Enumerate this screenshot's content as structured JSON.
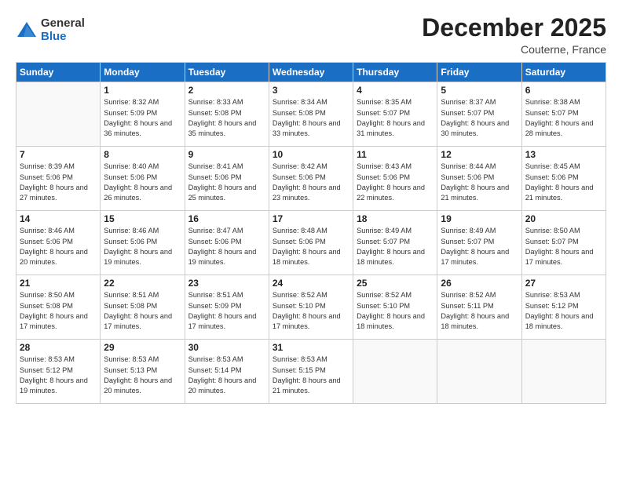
{
  "logo": {
    "general": "General",
    "blue": "Blue"
  },
  "title": "December 2025",
  "location": "Couterne, France",
  "weekdays": [
    "Sunday",
    "Monday",
    "Tuesday",
    "Wednesday",
    "Thursday",
    "Friday",
    "Saturday"
  ],
  "weeks": [
    [
      {
        "num": "",
        "sunrise": "",
        "sunset": "",
        "daylight": ""
      },
      {
        "num": "1",
        "sunrise": "Sunrise: 8:32 AM",
        "sunset": "Sunset: 5:09 PM",
        "daylight": "Daylight: 8 hours and 36 minutes."
      },
      {
        "num": "2",
        "sunrise": "Sunrise: 8:33 AM",
        "sunset": "Sunset: 5:08 PM",
        "daylight": "Daylight: 8 hours and 35 minutes."
      },
      {
        "num": "3",
        "sunrise": "Sunrise: 8:34 AM",
        "sunset": "Sunset: 5:08 PM",
        "daylight": "Daylight: 8 hours and 33 minutes."
      },
      {
        "num": "4",
        "sunrise": "Sunrise: 8:35 AM",
        "sunset": "Sunset: 5:07 PM",
        "daylight": "Daylight: 8 hours and 31 minutes."
      },
      {
        "num": "5",
        "sunrise": "Sunrise: 8:37 AM",
        "sunset": "Sunset: 5:07 PM",
        "daylight": "Daylight: 8 hours and 30 minutes."
      },
      {
        "num": "6",
        "sunrise": "Sunrise: 8:38 AM",
        "sunset": "Sunset: 5:07 PM",
        "daylight": "Daylight: 8 hours and 28 minutes."
      }
    ],
    [
      {
        "num": "7",
        "sunrise": "Sunrise: 8:39 AM",
        "sunset": "Sunset: 5:06 PM",
        "daylight": "Daylight: 8 hours and 27 minutes."
      },
      {
        "num": "8",
        "sunrise": "Sunrise: 8:40 AM",
        "sunset": "Sunset: 5:06 PM",
        "daylight": "Daylight: 8 hours and 26 minutes."
      },
      {
        "num": "9",
        "sunrise": "Sunrise: 8:41 AM",
        "sunset": "Sunset: 5:06 PM",
        "daylight": "Daylight: 8 hours and 25 minutes."
      },
      {
        "num": "10",
        "sunrise": "Sunrise: 8:42 AM",
        "sunset": "Sunset: 5:06 PM",
        "daylight": "Daylight: 8 hours and 23 minutes."
      },
      {
        "num": "11",
        "sunrise": "Sunrise: 8:43 AM",
        "sunset": "Sunset: 5:06 PM",
        "daylight": "Daylight: 8 hours and 22 minutes."
      },
      {
        "num": "12",
        "sunrise": "Sunrise: 8:44 AM",
        "sunset": "Sunset: 5:06 PM",
        "daylight": "Daylight: 8 hours and 21 minutes."
      },
      {
        "num": "13",
        "sunrise": "Sunrise: 8:45 AM",
        "sunset": "Sunset: 5:06 PM",
        "daylight": "Daylight: 8 hours and 21 minutes."
      }
    ],
    [
      {
        "num": "14",
        "sunrise": "Sunrise: 8:46 AM",
        "sunset": "Sunset: 5:06 PM",
        "daylight": "Daylight: 8 hours and 20 minutes."
      },
      {
        "num": "15",
        "sunrise": "Sunrise: 8:46 AM",
        "sunset": "Sunset: 5:06 PM",
        "daylight": "Daylight: 8 hours and 19 minutes."
      },
      {
        "num": "16",
        "sunrise": "Sunrise: 8:47 AM",
        "sunset": "Sunset: 5:06 PM",
        "daylight": "Daylight: 8 hours and 19 minutes."
      },
      {
        "num": "17",
        "sunrise": "Sunrise: 8:48 AM",
        "sunset": "Sunset: 5:06 PM",
        "daylight": "Daylight: 8 hours and 18 minutes."
      },
      {
        "num": "18",
        "sunrise": "Sunrise: 8:49 AM",
        "sunset": "Sunset: 5:07 PM",
        "daylight": "Daylight: 8 hours and 18 minutes."
      },
      {
        "num": "19",
        "sunrise": "Sunrise: 8:49 AM",
        "sunset": "Sunset: 5:07 PM",
        "daylight": "Daylight: 8 hours and 17 minutes."
      },
      {
        "num": "20",
        "sunrise": "Sunrise: 8:50 AM",
        "sunset": "Sunset: 5:07 PM",
        "daylight": "Daylight: 8 hours and 17 minutes."
      }
    ],
    [
      {
        "num": "21",
        "sunrise": "Sunrise: 8:50 AM",
        "sunset": "Sunset: 5:08 PM",
        "daylight": "Daylight: 8 hours and 17 minutes."
      },
      {
        "num": "22",
        "sunrise": "Sunrise: 8:51 AM",
        "sunset": "Sunset: 5:08 PM",
        "daylight": "Daylight: 8 hours and 17 minutes."
      },
      {
        "num": "23",
        "sunrise": "Sunrise: 8:51 AM",
        "sunset": "Sunset: 5:09 PM",
        "daylight": "Daylight: 8 hours and 17 minutes."
      },
      {
        "num": "24",
        "sunrise": "Sunrise: 8:52 AM",
        "sunset": "Sunset: 5:10 PM",
        "daylight": "Daylight: 8 hours and 17 minutes."
      },
      {
        "num": "25",
        "sunrise": "Sunrise: 8:52 AM",
        "sunset": "Sunset: 5:10 PM",
        "daylight": "Daylight: 8 hours and 18 minutes."
      },
      {
        "num": "26",
        "sunrise": "Sunrise: 8:52 AM",
        "sunset": "Sunset: 5:11 PM",
        "daylight": "Daylight: 8 hours and 18 minutes."
      },
      {
        "num": "27",
        "sunrise": "Sunrise: 8:53 AM",
        "sunset": "Sunset: 5:12 PM",
        "daylight": "Daylight: 8 hours and 18 minutes."
      }
    ],
    [
      {
        "num": "28",
        "sunrise": "Sunrise: 8:53 AM",
        "sunset": "Sunset: 5:12 PM",
        "daylight": "Daylight: 8 hours and 19 minutes."
      },
      {
        "num": "29",
        "sunrise": "Sunrise: 8:53 AM",
        "sunset": "Sunset: 5:13 PM",
        "daylight": "Daylight: 8 hours and 20 minutes."
      },
      {
        "num": "30",
        "sunrise": "Sunrise: 8:53 AM",
        "sunset": "Sunset: 5:14 PM",
        "daylight": "Daylight: 8 hours and 20 minutes."
      },
      {
        "num": "31",
        "sunrise": "Sunrise: 8:53 AM",
        "sunset": "Sunset: 5:15 PM",
        "daylight": "Daylight: 8 hours and 21 minutes."
      },
      {
        "num": "",
        "sunrise": "",
        "sunset": "",
        "daylight": ""
      },
      {
        "num": "",
        "sunrise": "",
        "sunset": "",
        "daylight": ""
      },
      {
        "num": "",
        "sunrise": "",
        "sunset": "",
        "daylight": ""
      }
    ]
  ]
}
